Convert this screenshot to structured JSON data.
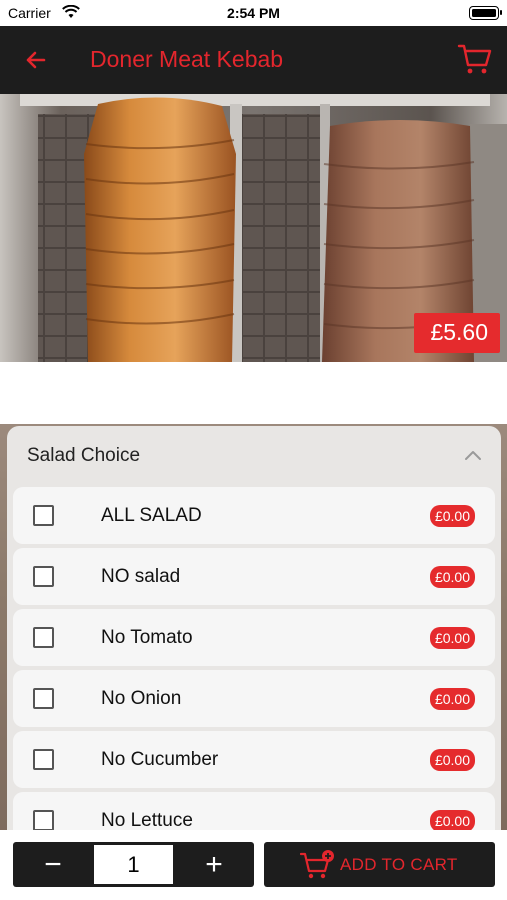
{
  "status_bar": {
    "carrier": "Carrier",
    "time": "2:54 PM"
  },
  "header": {
    "title": "Doner Meat Kebab",
    "back_icon": "arrow-left-icon",
    "cart_icon": "cart-icon"
  },
  "product": {
    "price": "£5.60"
  },
  "options_panel": {
    "title": "Salad Choice",
    "expanded": true,
    "options": [
      {
        "label": "ALL SALAD",
        "price": "£0.00",
        "checked": false
      },
      {
        "label": "NO salad",
        "price": "£0.00",
        "checked": false
      },
      {
        "label": "No Tomato",
        "price": "£0.00",
        "checked": false
      },
      {
        "label": "No Onion",
        "price": "£0.00",
        "checked": false
      },
      {
        "label": "No Cucumber",
        "price": "£0.00",
        "checked": false
      },
      {
        "label": "No Lettuce",
        "price": "£0.00",
        "checked": false
      }
    ]
  },
  "footer": {
    "minus": "−",
    "quantity": "1",
    "plus": "+",
    "add_to_cart": "ADD TO CART"
  },
  "colors": {
    "accent": "#e3262d",
    "bar_dark": "#1d1d1d"
  }
}
